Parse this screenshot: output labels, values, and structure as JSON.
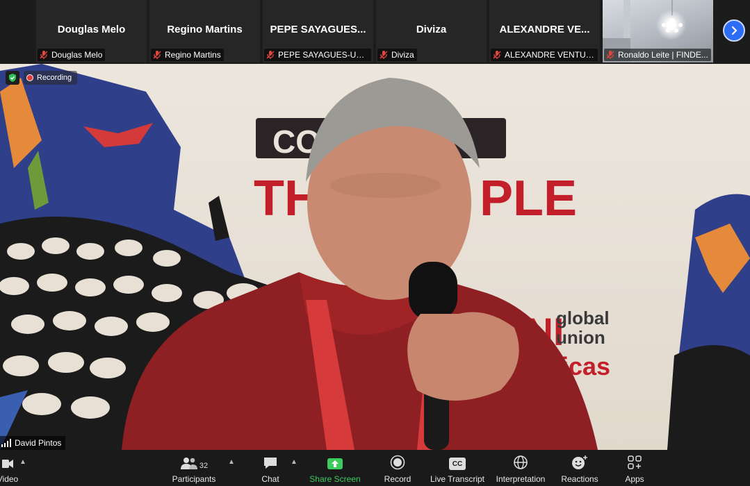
{
  "thumbnails": [
    {
      "display": "Douglas Melo",
      "label": "Douglas Melo"
    },
    {
      "display": "Regino Martins",
      "label": "Regino Martins"
    },
    {
      "display": "PEPE SAYAGUES...",
      "label": "PEPE SAYAGUES-UGT ..."
    },
    {
      "display": "Diviza",
      "label": "Diviza"
    },
    {
      "display": "ALEXANDRE VE...",
      "label": "ALEXANDRE VENTURY"
    },
    {
      "display": "",
      "label": "Ronaldo Leite | FINDE..."
    }
  ],
  "recording": {
    "label": "Recording"
  },
  "speaker": {
    "name": "David Pintos"
  },
  "background_text": {
    "banner_top": "CO",
    "banner_bottom_left": "TH",
    "banner_bottom_right": "PLE",
    "logo_left": "UNI",
    "logo_line1": "global",
    "logo_line2": "union",
    "logo_line3": "icas"
  },
  "toolbar": {
    "video_label": "Video",
    "participants_label": "Participants",
    "participants_count": "32",
    "chat_label": "Chat",
    "share_label": "Share Screen",
    "record_label": "Record",
    "transcript_label": "Live Transcript",
    "transcript_icon_text": "CC",
    "interpretation_label": "Interpretation",
    "reactions_label": "Reactions",
    "apps_label": "Apps"
  },
  "colors": {
    "share_green": "#3ecb5d",
    "next_button": "#2d6df6",
    "mute_red": "#e0463c"
  }
}
